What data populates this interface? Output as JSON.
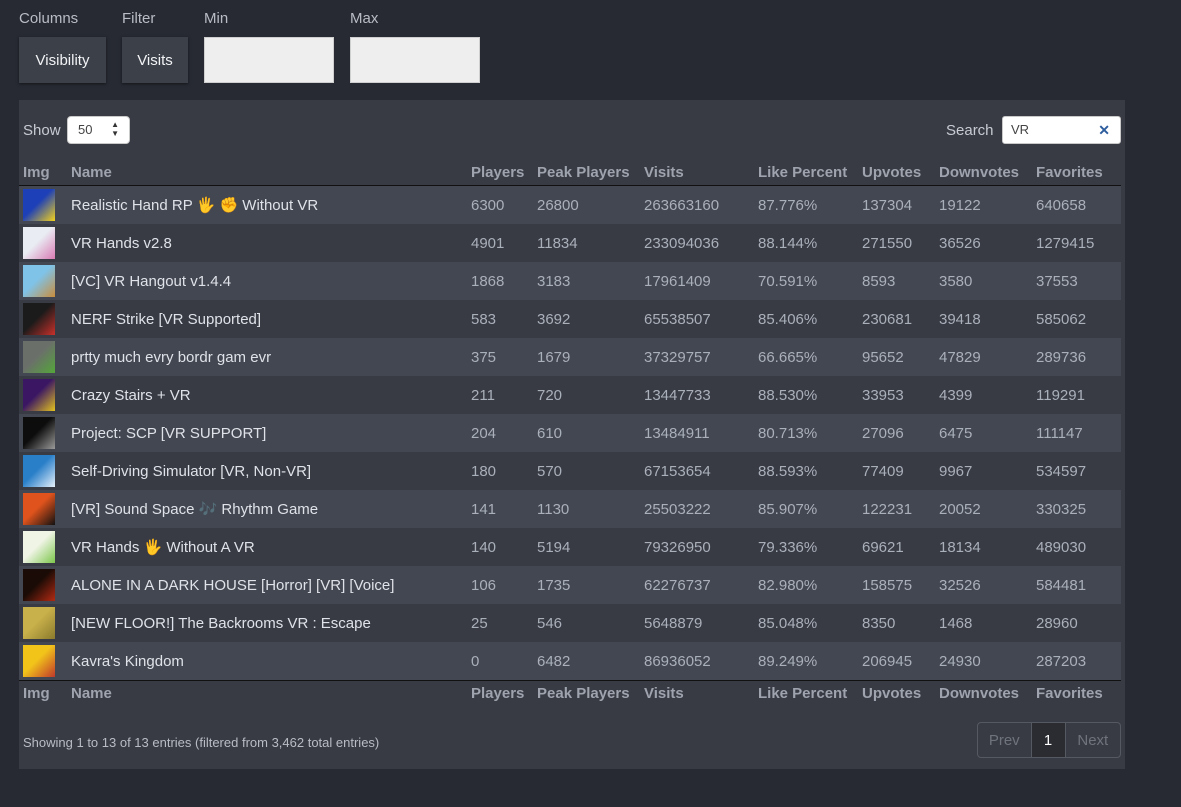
{
  "controls": {
    "columns_label": "Columns",
    "filter_label": "Filter",
    "min_label": "Min",
    "max_label": "Max",
    "visibility_button": "Visibility",
    "visits_button": "Visits",
    "min_value": "",
    "max_value": ""
  },
  "table_controls": {
    "show_label": "Show",
    "page_length": "50",
    "search_label": "Search",
    "search_value": "VR",
    "clear_glyph": "✕"
  },
  "columns": [
    "Img",
    "Name",
    "Players",
    "Peak Players",
    "Visits",
    "Like Percent",
    "Upvotes",
    "Downvotes",
    "Favorites"
  ],
  "rows": [
    {
      "name": "Realistic Hand RP 🖐 ✊ Without VR",
      "players": "6300",
      "peak": "26800",
      "visits": "263663160",
      "like": "87.776%",
      "up": "137304",
      "down": "19122",
      "fav": "640658",
      "thumb": [
        "#1d3fb8",
        "#f2d21b"
      ]
    },
    {
      "name": "VR Hands v2.8",
      "players": "4901",
      "peak": "11834",
      "visits": "233094036",
      "like": "88.144%",
      "up": "271550",
      "down": "36526",
      "fav": "1279415",
      "thumb": [
        "#e9ecf3",
        "#d97ab3"
      ]
    },
    {
      "name": "[VC] VR Hangout v1.4.4",
      "players": "1868",
      "peak": "3183",
      "visits": "17961409",
      "like": "70.591%",
      "up": "8593",
      "down": "3580",
      "fav": "37553",
      "thumb": [
        "#7fc3e8",
        "#c98d3c"
      ]
    },
    {
      "name": "NERF Strike [VR Supported]",
      "players": "583",
      "peak": "3692",
      "visits": "65538507",
      "like": "85.406%",
      "up": "230681",
      "down": "39418",
      "fav": "585062",
      "thumb": [
        "#1b1b1b",
        "#c9302a"
      ]
    },
    {
      "name": "prtty much evry bordr gam evr",
      "players": "375",
      "peak": "1679",
      "visits": "37329757",
      "like": "66.665%",
      "up": "95652",
      "down": "47829",
      "fav": "289736",
      "thumb": [
        "#6b6f6a",
        "#54a63a"
      ]
    },
    {
      "name": "Crazy Stairs + VR",
      "players": "211",
      "peak": "720",
      "visits": "13447733",
      "like": "88.530%",
      "up": "33953",
      "down": "4399",
      "fav": "119291",
      "thumb": [
        "#3b1763",
        "#e3c21f"
      ]
    },
    {
      "name": "Project: SCP [VR SUPPORT]",
      "players": "204",
      "peak": "610",
      "visits": "13484911",
      "like": "80.713%",
      "up": "27096",
      "down": "6475",
      "fav": "111147",
      "thumb": [
        "#0d0d0d",
        "#9a9a9a"
      ]
    },
    {
      "name": "Self-Driving Simulator [VR, Non-VR]",
      "players": "180",
      "peak": "570",
      "visits": "67153654",
      "like": "88.593%",
      "up": "77409",
      "down": "9967",
      "fav": "534597",
      "thumb": [
        "#2a7fc9",
        "#e6f0fa"
      ]
    },
    {
      "name": "[VR] Sound Space 🎶 Rhythm Game",
      "players": "141",
      "peak": "1130",
      "visits": "25503222",
      "like": "85.907%",
      "up": "122231",
      "down": "20052",
      "fav": "330325",
      "thumb": [
        "#e0531c",
        "#111111"
      ]
    },
    {
      "name": "VR Hands 🖐 Without A VR",
      "players": "140",
      "peak": "5194",
      "visits": "79326950",
      "like": "79.336%",
      "up": "69621",
      "down": "18134",
      "fav": "489030",
      "thumb": [
        "#f0f4e6",
        "#7cc64b"
      ]
    },
    {
      "name": "ALONE IN A DARK HOUSE [Horror] [VR] [Voice]",
      "players": "106",
      "peak": "1735",
      "visits": "62276737",
      "like": "82.980%",
      "up": "158575",
      "down": "32526",
      "fav": "584481",
      "thumb": [
        "#1a0b06",
        "#b32a12"
      ]
    },
    {
      "name": "[NEW FLOOR!] The Backrooms VR : Escape",
      "players": "25",
      "peak": "546",
      "visits": "5648879",
      "like": "85.048%",
      "up": "8350",
      "down": "1468",
      "fav": "28960",
      "thumb": [
        "#c8b04a",
        "#8a7a2c"
      ]
    },
    {
      "name": "Kavra's Kingdom",
      "players": "0",
      "peak": "6482",
      "visits": "86936052",
      "like": "89.249%",
      "up": "206945",
      "down": "24930",
      "fav": "287203",
      "thumb": [
        "#f2c41a",
        "#c0392b"
      ]
    }
  ],
  "footer": {
    "info": "Showing 1 to 13 of 13 entries (filtered from 3,462 total entries)",
    "prev": "Prev",
    "page": "1",
    "next": "Next"
  }
}
